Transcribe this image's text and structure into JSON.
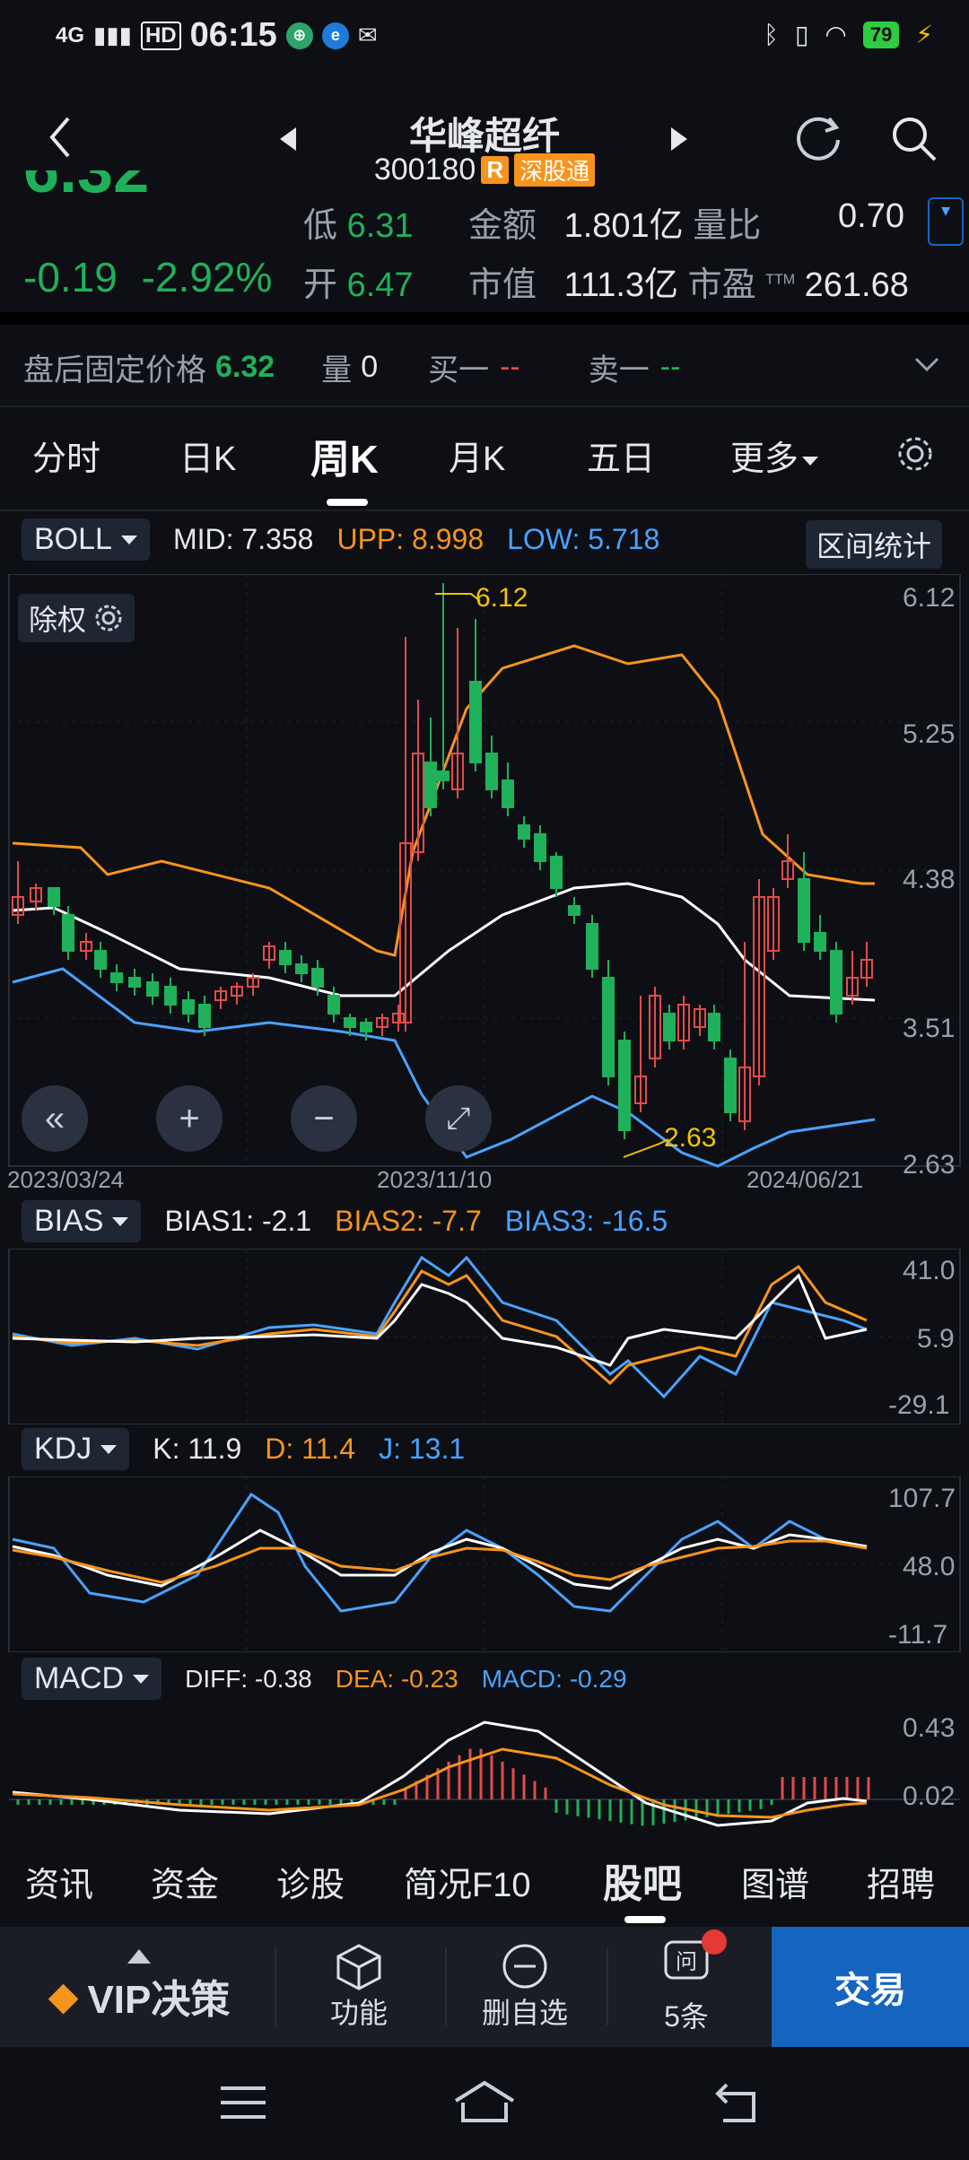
{
  "status": {
    "network": "4G",
    "hd": "HD",
    "time": "06:15",
    "battery": "79"
  },
  "header": {
    "title": "华峰超纤",
    "code": "300180",
    "badge_r": "R",
    "badge_market": "深股通"
  },
  "quote": {
    "price_partial": "6.32",
    "low_label": "低",
    "low_value": "6.31",
    "amount_label": "金额",
    "amount_value": "1.801亿",
    "vol_ratio_label": "量比",
    "vol_ratio_value": "0.70",
    "change": "-0.19",
    "change_pct": "-2.92%",
    "open_label": "开",
    "open_value": "6.47",
    "mktcap_label": "市值",
    "mktcap_value": "111.3亿",
    "pe_label": "市盈",
    "pe_sup": "TTM",
    "pe_value": "261.68"
  },
  "postmarket": {
    "label": "盘后固定价格",
    "price": "6.32",
    "vol_label": "量",
    "vol_value": "0",
    "buy_label": "买一",
    "buy_value": "--",
    "sell_label": "卖一",
    "sell_value": "--"
  },
  "tabs": [
    "分时",
    "日K",
    "周K",
    "月K",
    "五日",
    "更多"
  ],
  "active_tab": "周K",
  "boll": {
    "name": "BOLL",
    "mid_label": "MID:",
    "mid": "7.358",
    "upp_label": "UPP:",
    "upp": "8.998",
    "low_label": "LOW:",
    "low": "5.718",
    "range_btn": "区间统计",
    "exright": "除权"
  },
  "main_chart": {
    "y_ticks": [
      "6.12",
      "5.25",
      "4.38",
      "3.51",
      "2.63"
    ],
    "dates": [
      "2023/03/24",
      "2023/11/10",
      "2024/06/21"
    ],
    "high_label": "6.12",
    "low_label": "2.63"
  },
  "bias": {
    "name": "BIAS",
    "b1_label": "BIAS1:",
    "b1": "-2.1",
    "b2_label": "BIAS2:",
    "b2": "-7.7",
    "b3_label": "BIAS3:",
    "b3": "-16.5",
    "y_ticks": [
      "41.0",
      "5.9",
      "-29.1"
    ]
  },
  "kdj": {
    "name": "KDJ",
    "k_label": "K:",
    "k": "11.9",
    "d_label": "D:",
    "d": "11.4",
    "j_label": "J:",
    "j": "13.1",
    "y_ticks": [
      "107.7",
      "48.0",
      "-11.7"
    ]
  },
  "macd": {
    "name": "MACD",
    "diff_label": "DIFF:",
    "diff": "-0.38",
    "dea_label": "DEA:",
    "dea": "-0.23",
    "macd_label": "MACD:",
    "macd": "-0.29",
    "y_ticks": [
      "0.43",
      "0.02"
    ]
  },
  "subtabs": [
    "资讯",
    "资金",
    "诊股",
    "简况F10",
    "股吧",
    "图谱",
    "招聘"
  ],
  "active_subtab": "股吧",
  "bottom": {
    "vip": "VIP决策",
    "func": "功能",
    "remove": "删自选",
    "ask": "5条",
    "trade": "交易"
  },
  "colors": {
    "up": "#e34b4b",
    "down": "#1fb15a",
    "orange": "#f7941d",
    "blue": "#4aa3ff",
    "white": "#ffffff",
    "yellow": "#f5c300"
  }
}
